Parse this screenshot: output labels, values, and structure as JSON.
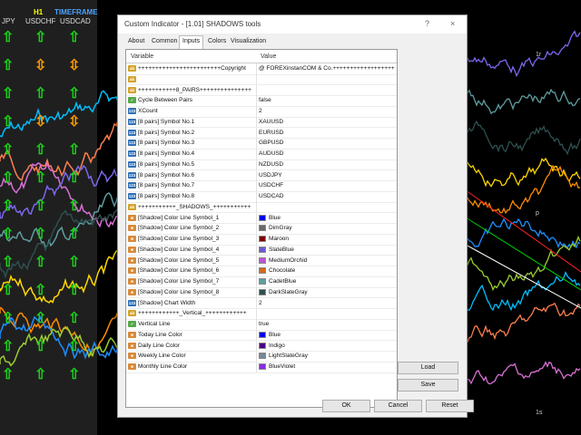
{
  "chart": {
    "h1_label": "H1",
    "timeframe_label": "TIMEFRAME",
    "symbol_headers": [
      "JPY",
      "USDCHF",
      "USDCAD"
    ],
    "right_labels": [
      "1r",
      "p",
      "1s"
    ],
    "arrow_columns": [
      [
        "up",
        "up",
        "up",
        "up",
        "up",
        "up",
        "up",
        "up",
        "up",
        "up",
        "up",
        "up",
        "up"
      ],
      [
        "up",
        "updown",
        "up",
        "updown",
        "up",
        "up",
        "up",
        "up",
        "up",
        "up",
        "up",
        "up",
        "up"
      ],
      [
        "up",
        "updown",
        "up",
        "updown",
        "up",
        "up",
        "up",
        "up",
        "up",
        "up",
        "up",
        "up",
        "up"
      ]
    ],
    "colors": {
      "up": "#19d419",
      "updown": "#ff9900",
      "down": "#ff2222"
    }
  },
  "dialog": {
    "title": "Custom Indicator - [1.01] SHADOWS tools",
    "help_icon": "?",
    "close_icon": "×",
    "tabs": [
      "About",
      "Common",
      "Inputs",
      "Colors",
      "Visualization"
    ],
    "active_tab": "Inputs",
    "columns": {
      "variable": "Variable",
      "value": "Value"
    },
    "rows": [
      {
        "icon": "ab",
        "name": "++++++++++++++++++++++++Copyright",
        "value": "@ FOREXinstanCOM & Co.++++++++++++++++++"
      },
      {
        "icon": "ab",
        "name": "",
        "value": ""
      },
      {
        "icon": "ab",
        "name": "+++++++++++8_PAIRS+++++++++++++++",
        "value": ""
      },
      {
        "icon": "bool",
        "name": "Cycle Between Pairs",
        "value": "false"
      },
      {
        "icon": "num",
        "name": "XCount",
        "value": "2"
      },
      {
        "icon": "num",
        "name": "[8 pairs] Symbol No.1",
        "value": "XAUUSD"
      },
      {
        "icon": "num",
        "name": "[8 pairs] Symbol No.2",
        "value": "EURUSD"
      },
      {
        "icon": "num",
        "name": "[8 pairs] Symbol No.3",
        "value": "GBPUSD"
      },
      {
        "icon": "num",
        "name": "[8 pairs] Symbol No.4",
        "value": "AUDUSD"
      },
      {
        "icon": "num",
        "name": "[8 pairs] Symbol No.5",
        "value": "NZDUSD"
      },
      {
        "icon": "num",
        "name": "[8 pairs] Symbol No.6",
        "value": "USDJPY"
      },
      {
        "icon": "num",
        "name": "[8 pairs] Symbol No.7",
        "value": "USDCHF"
      },
      {
        "icon": "num",
        "name": "[8 pairs] Symbol No.8",
        "value": "USDCAD"
      },
      {
        "icon": "ab",
        "name": "+++++++++++_SHADOWS_+++++++++++",
        "value": ""
      },
      {
        "icon": "col",
        "name": "[Shadow] Color Line Symbol_1",
        "value": "Blue",
        "color": "#0000ff"
      },
      {
        "icon": "col",
        "name": "[Shadow] Color Line Symbol_2",
        "value": "DimGray",
        "color": "#696969"
      },
      {
        "icon": "col",
        "name": "[Shadow] Color Line Symbol_3",
        "value": "Maroon",
        "color": "#800000"
      },
      {
        "icon": "col",
        "name": "[Shadow] Color Line Symbol_4",
        "value": "SlateBlue",
        "color": "#6a5acd"
      },
      {
        "icon": "col",
        "name": "[Shadow] Color Line Symbol_5",
        "value": "MediumOrchid",
        "color": "#ba55d3"
      },
      {
        "icon": "col",
        "name": "[Shadow] Color Line Symbol_6",
        "value": "Chocolate",
        "color": "#d2691e"
      },
      {
        "icon": "col",
        "name": "[Shadow] Color Line Symbol_7",
        "value": "CadetBlue",
        "color": "#5f9ea0"
      },
      {
        "icon": "col",
        "name": "[Shadow] Color Line Symbol_8",
        "value": "DarkSlateGray",
        "color": "#2f4f4f"
      },
      {
        "icon": "num",
        "name": "[Shadow] Chart Width",
        "value": "2"
      },
      {
        "icon": "ab",
        "name": "++++++++++++_Vertical_++++++++++++",
        "value": ""
      },
      {
        "icon": "bool",
        "name": "Vertical Line",
        "value": "true"
      },
      {
        "icon": "col",
        "name": "Today Line Color",
        "value": "Blue",
        "color": "#0000ff"
      },
      {
        "icon": "col",
        "name": "Daily Line Color",
        "value": "Indigo",
        "color": "#4b0082"
      },
      {
        "icon": "col",
        "name": "Weekly Line Color",
        "value": "LightSlateGray",
        "color": "#778899"
      },
      {
        "icon": "col",
        "name": "Monthly Line Color",
        "value": "BlueViolet",
        "color": "#8a2be2"
      }
    ],
    "buttons": {
      "load": "Load",
      "save": "Save",
      "ok": "OK",
      "cancel": "Cancel",
      "reset": "Reset"
    }
  }
}
